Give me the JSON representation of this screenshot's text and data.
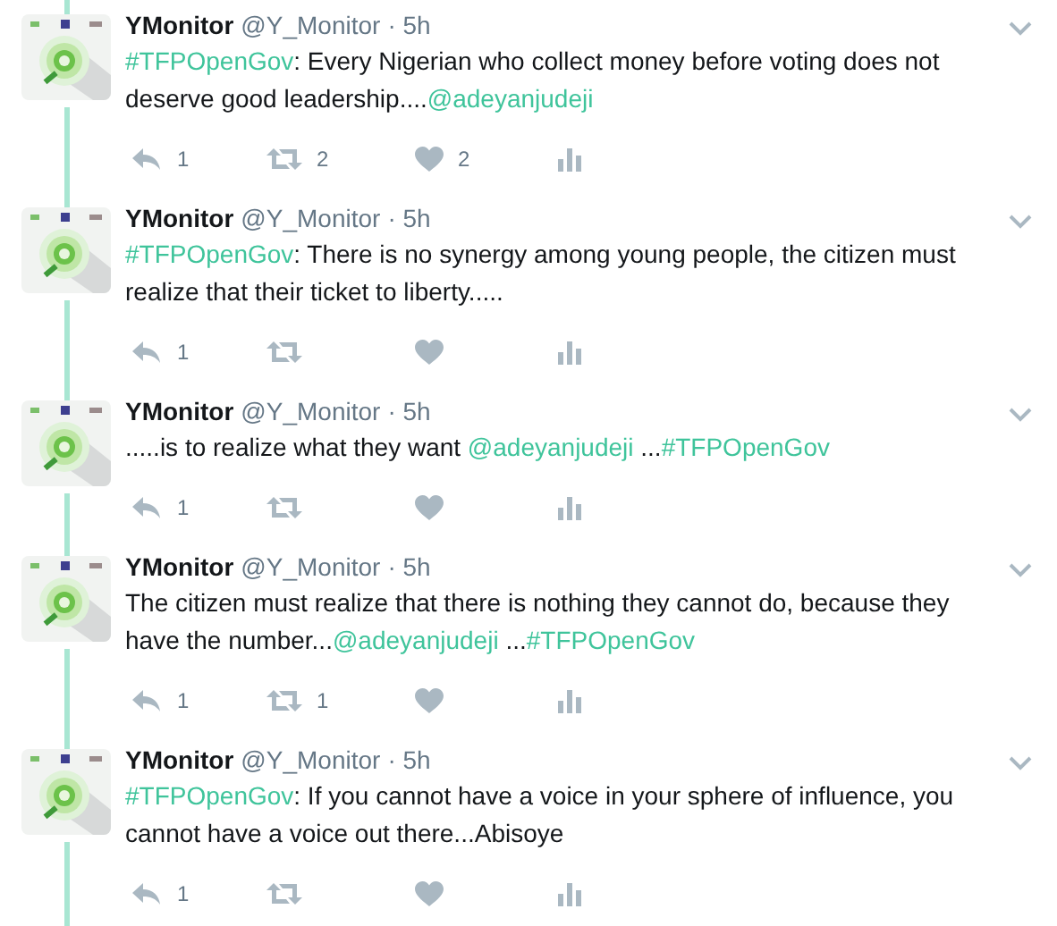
{
  "tweets": [
    {
      "name": "YMonitor",
      "handle": "@Y_Monitor",
      "time": "· 5h",
      "text": [
        {
          "kind": "hashtag",
          "text": "#TFPOpenGov"
        },
        {
          "kind": "plain",
          "text": ": Every Nigerian who collect money before voting does not deserve good leadership...."
        },
        {
          "kind": "mention",
          "text": "@adeyanjudeji"
        }
      ],
      "replies": "1",
      "retweets": "2",
      "likes": "2"
    },
    {
      "name": "YMonitor",
      "handle": "@Y_Monitor",
      "time": "· 5h",
      "text": [
        {
          "kind": "hashtag",
          "text": "#TFPOpenGov"
        },
        {
          "kind": "plain",
          "text": ": There is no synergy among young people, the citizen must realize that their ticket to liberty....."
        }
      ],
      "replies": "1"
    },
    {
      "name": "YMonitor",
      "handle": "@Y_Monitor",
      "time": "· 5h",
      "text": [
        {
          "kind": "plain",
          "text": ".....is to realize what they want "
        },
        {
          "kind": "mention",
          "text": "@adeyanjudeji"
        },
        {
          "kind": "plain",
          "text": " ..."
        },
        {
          "kind": "hashtag",
          "text": "#TFPOpenGov"
        }
      ],
      "replies": "1"
    },
    {
      "name": "YMonitor",
      "handle": "@Y_Monitor",
      "time": "· 5h",
      "text": [
        {
          "kind": "plain",
          "text": "The citizen must realize that there is nothing they cannot do, because they have the number..."
        },
        {
          "kind": "mention",
          "text": "@adeyanjudeji"
        },
        {
          "kind": "plain",
          "text": " ..."
        },
        {
          "kind": "hashtag",
          "text": "#TFPOpenGov"
        }
      ],
      "replies": "1",
      "retweets": "1"
    },
    {
      "name": "YMonitor",
      "handle": "@Y_Monitor",
      "time": "· 5h",
      "text": [
        {
          "kind": "hashtag",
          "text": "#TFPOpenGov"
        },
        {
          "kind": "plain",
          "text": ": If you cannot have a voice in your sphere of influence, you cannot have a voice out there...Abisoye"
        }
      ],
      "replies": "1"
    }
  ]
}
